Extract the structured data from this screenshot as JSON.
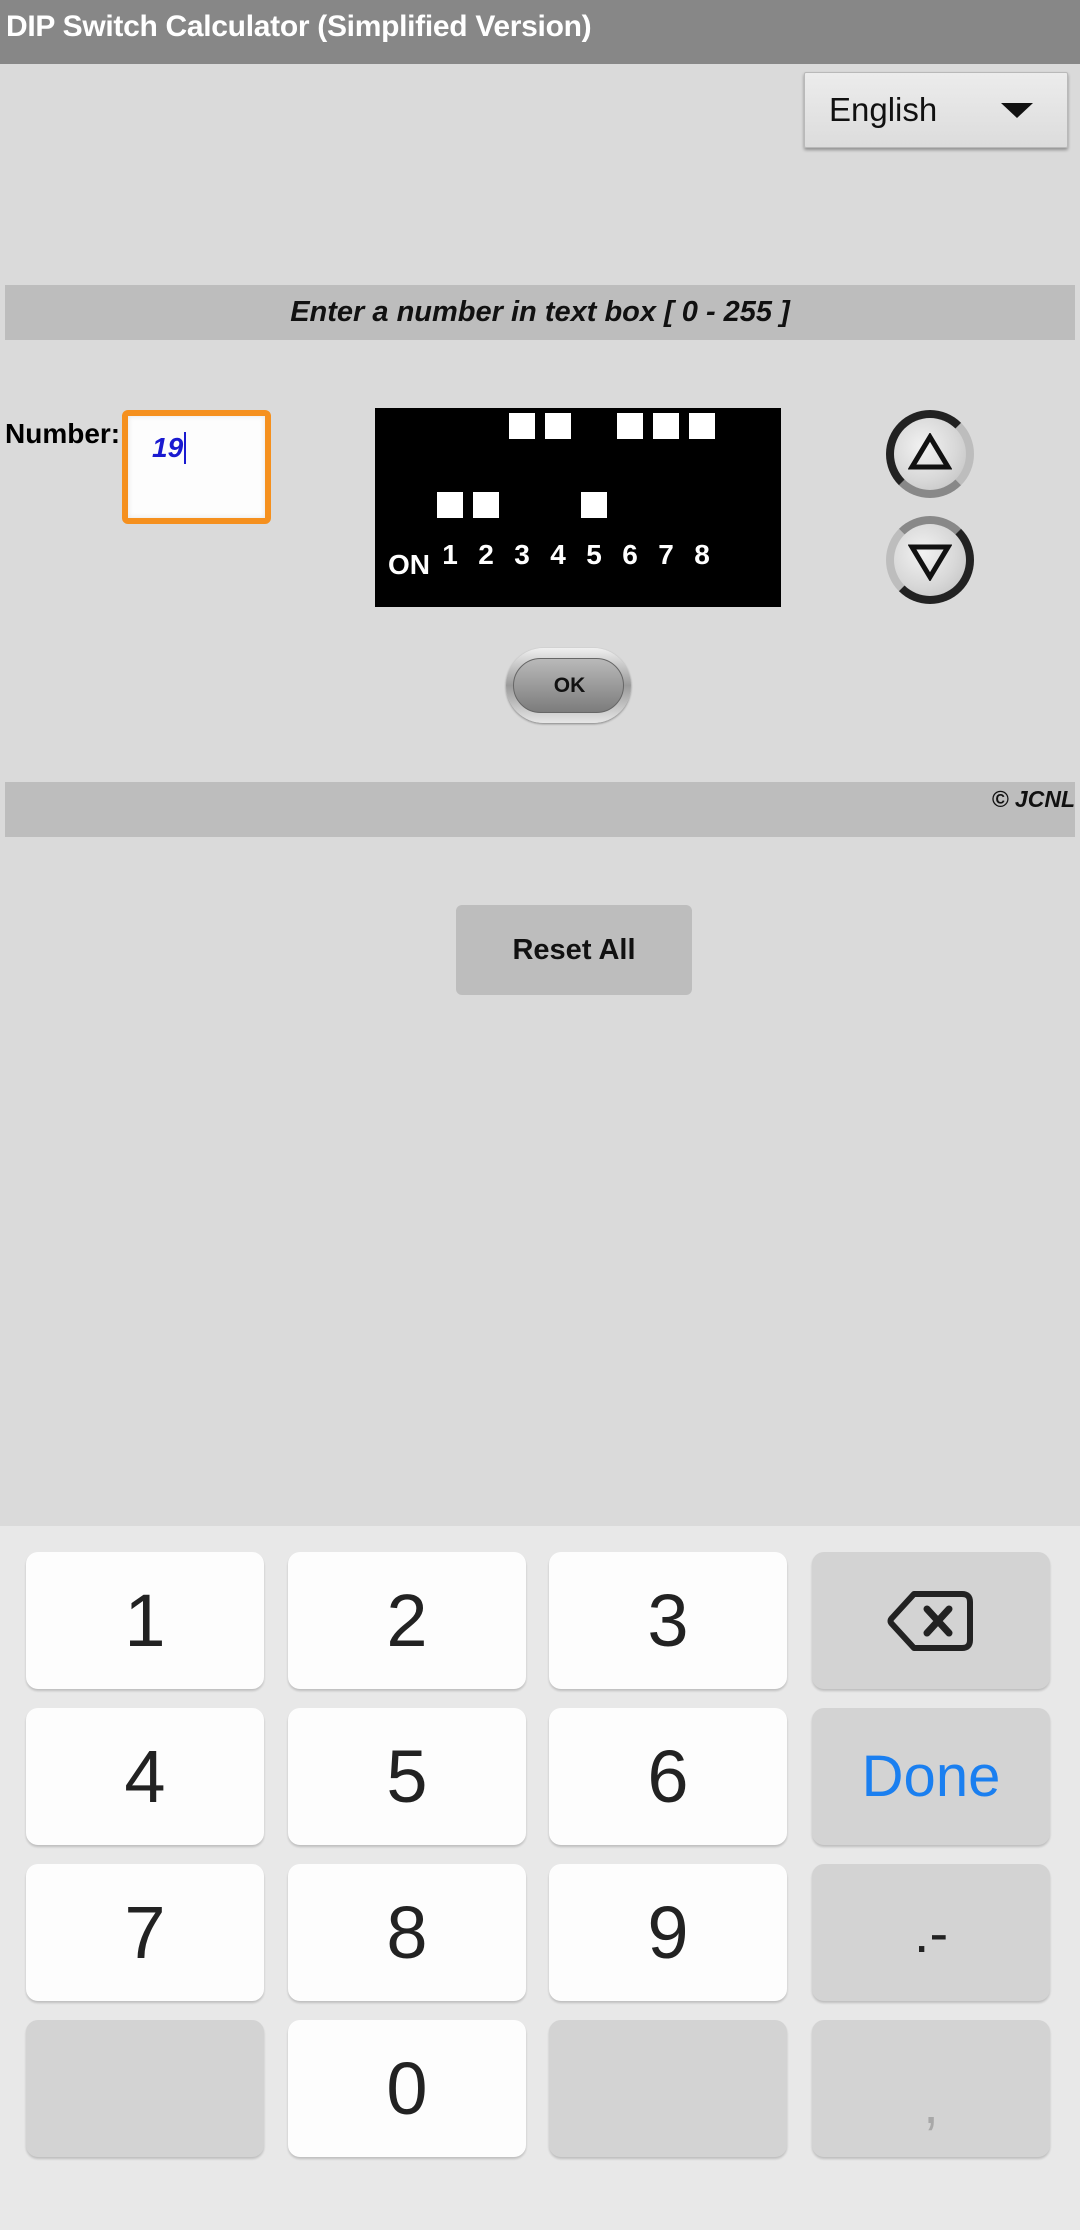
{
  "app": {
    "title": "DIP Switch Calculator (Simplified Version)"
  },
  "language_select": {
    "selected": "English",
    "icon": "dropdown-arrow-icon"
  },
  "instruction": "Enter a number in text box [ 0 - 255 ]",
  "number_field": {
    "label": "Number:",
    "value": "19",
    "focused": true,
    "accent_color": "#f5901e",
    "text_color": "#1a1ad0"
  },
  "dip_switch": {
    "on_label": "ON",
    "switches": [
      {
        "number": "1",
        "state": "on"
      },
      {
        "number": "2",
        "state": "on"
      },
      {
        "number": "3",
        "state": "off"
      },
      {
        "number": "4",
        "state": "off"
      },
      {
        "number": "5",
        "state": "on"
      },
      {
        "number": "6",
        "state": "off"
      },
      {
        "number": "7",
        "state": "off"
      },
      {
        "number": "8",
        "state": "off"
      }
    ]
  },
  "stepper": {
    "up_icon": "triangle-up-icon",
    "down_icon": "triangle-down-icon"
  },
  "ok_button": {
    "label": "OK"
  },
  "footer": {
    "copyright": "© JCNL"
  },
  "reset_button": {
    "label": "Reset All"
  },
  "keyboard": {
    "keys": [
      {
        "label": "1",
        "style": "white"
      },
      {
        "label": "2",
        "style": "white"
      },
      {
        "label": "3",
        "style": "white"
      },
      {
        "label": "",
        "style": "gray",
        "icon": "backspace-icon"
      },
      {
        "label": "4",
        "style": "white"
      },
      {
        "label": "5",
        "style": "white"
      },
      {
        "label": "6",
        "style": "white"
      },
      {
        "label": "Done",
        "style": "gray"
      },
      {
        "label": "7",
        "style": "white"
      },
      {
        "label": "8",
        "style": "white"
      },
      {
        "label": "9",
        "style": "white"
      },
      {
        "label": ".-",
        "style": "gray"
      },
      {
        "label": "",
        "style": "gray"
      },
      {
        "label": "0",
        "style": "white"
      },
      {
        "label": "",
        "style": "gray"
      },
      {
        "label": ",",
        "style": "gray"
      }
    ],
    "done_color": "#1a7ff0"
  }
}
